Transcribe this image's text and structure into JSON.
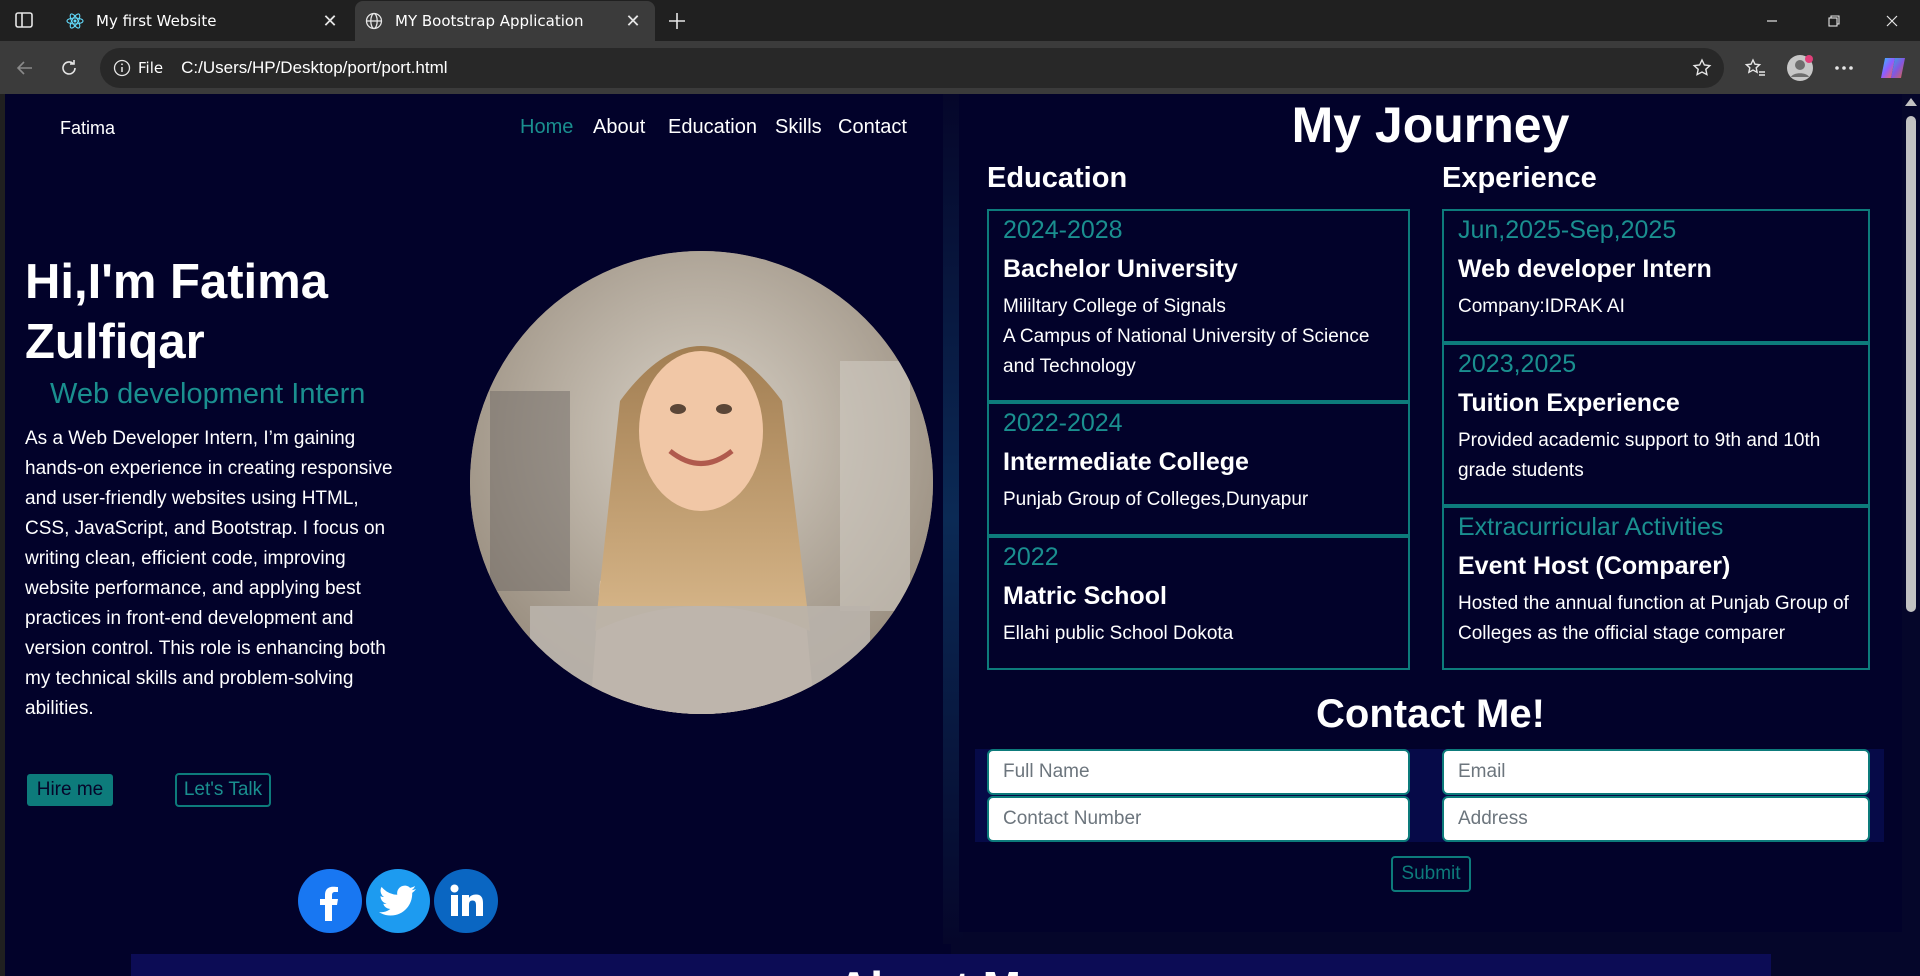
{
  "browser": {
    "tabs": [
      {
        "title": "My first Website",
        "icon": "react-icon",
        "active": false
      },
      {
        "title": "MY Bootstrap Application",
        "icon": "globe-icon",
        "active": true
      }
    ],
    "address": {
      "scheme_label": "File",
      "url": "C:/Users/HP/Desktop/port/port.html"
    }
  },
  "nav": {
    "brand": "Fatima",
    "links": [
      "Home",
      "About",
      "Education",
      "Skills",
      "Contact"
    ]
  },
  "hero": {
    "greeting": "Hi,I'm Fatima Zulfiqar",
    "role": "Web development Intern",
    "intro": "As a Web Developer Intern, I’m gaining hands-on experience in creating responsive and user-friendly websites using HTML, CSS, JavaScript, and Bootstrap. I focus on writing clean, efficient code, improving website performance, and applying best practices in front-end development and version control. This role is enhancing both my technical skills and problem-solving abilities.",
    "hire_label": "Hire me",
    "talk_label": "Let's Talk"
  },
  "social": [
    "facebook-icon",
    "twitter-icon",
    "linkedin-icon"
  ],
  "about_heading": "About Me",
  "journey": {
    "title": "My Journey",
    "education_heading": "Education",
    "experience_heading": "Experience",
    "education": [
      {
        "year": "2024-2028",
        "title": "Bachelor University",
        "lines": [
          "Mililtary College of Signals",
          "A Campus of National University of Science and Technology"
        ]
      },
      {
        "year": "2022-2024",
        "title": "Intermediate College",
        "lines": [
          "Punjab Group of Colleges,Dunyapur"
        ]
      },
      {
        "year": "2022",
        "title": "Matric School",
        "lines": [
          "Ellahi public School Dokota"
        ]
      }
    ],
    "experience": [
      {
        "year": "Jun,2025-Sep,2025",
        "title": "Web developer Intern",
        "lines": [
          "Company:IDRAK AI"
        ]
      },
      {
        "year": "2023,2025",
        "title": "Tuition Experience",
        "lines": [
          "Provided academic support to 9th and 10th grade students"
        ]
      },
      {
        "year": "Extracurricular Activities",
        "title": "Event Host (Comparer)",
        "lines": [
          "Hosted the annual function at Punjab Group of Colleges as the official stage comparer"
        ]
      }
    ]
  },
  "contact": {
    "title": "Contact Me!",
    "fields": {
      "full_name": "Full Name",
      "email": "Email",
      "contact_number": "Contact Number",
      "address": "Address"
    },
    "submit_label": "Submit"
  },
  "colors": {
    "accent": "#0d7b7b",
    "background": "#02022a"
  }
}
